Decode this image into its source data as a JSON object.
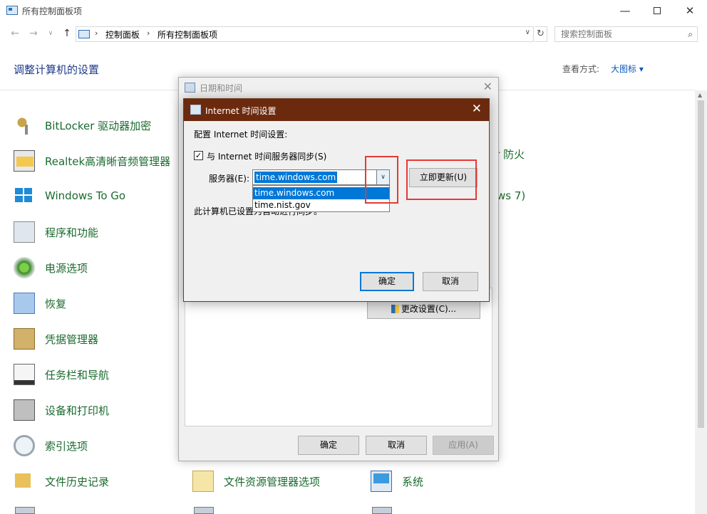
{
  "window": {
    "title": "所有控制面板项",
    "controls": {
      "minimize": "—",
      "close": "✕"
    }
  },
  "nav": {
    "back": "←",
    "forward": "→",
    "recent": "∨",
    "up": "↑",
    "breadcrumb": [
      "控制面板",
      "所有控制面板项"
    ],
    "separator": "›",
    "address_dropdown": "∨",
    "refresh": "↻",
    "search_placeholder": "搜索控制面板",
    "search_icon": "⌕"
  },
  "main": {
    "heading": "调整计算机的设置",
    "view_by_label": "查看方式:",
    "view_by_value": "大图标 ▾"
  },
  "items_col1": [
    {
      "label": "BitLocker 驱动器加密",
      "icon": "bitlocker-icon"
    },
    {
      "label": "Realtek高清晰音频管理器",
      "icon": "realtek-icon"
    },
    {
      "label": "Windows To Go",
      "icon": "windows-to-go-icon"
    },
    {
      "label": "程序和功能",
      "icon": "programs-icon"
    },
    {
      "label": "电源选项",
      "icon": "power-icon"
    },
    {
      "label": "恢复",
      "icon": "recovery-icon"
    },
    {
      "label": "凭据管理器",
      "icon": "credential-icon"
    },
    {
      "label": "任务栏和导航",
      "icon": "taskbar-icon"
    },
    {
      "label": "设备和打印机",
      "icon": "devices-printers-icon"
    },
    {
      "label": "索引选项",
      "icon": "indexing-icon"
    },
    {
      "label": "文件历史记录",
      "icon": "file-history-icon"
    }
  ],
  "items_partial": [
    {
      "label": "er 防火"
    },
    {
      "label": "ws 7)"
    }
  ],
  "items_row_bottom": [
    {
      "label": "文件资源管理器选项",
      "icon": "file-explorer-options-icon"
    },
    {
      "label": "系统",
      "icon": "system-icon"
    }
  ],
  "datetime_dialog": {
    "title": "日期和时间",
    "close": "✕",
    "change_settings": "更改设置(C)...",
    "ok": "确定",
    "cancel": "取消",
    "apply": "应用(A)"
  },
  "internet_time_dialog": {
    "title": "Internet 时间设置",
    "close": "✕",
    "config_label": "配置 Internet 时间设置:",
    "sync_checked": "✓",
    "sync_label": "与 Internet 时间服务器同步(S)",
    "server_label": "服务器(E):",
    "server_value": "time.windows.com",
    "combo_arrow": "∨",
    "server_options": [
      "time.windows.com",
      "time.nist.gov"
    ],
    "update_now": "立即更新(U)",
    "status_text": "此计算机已设置为自动进行同步。",
    "ok": "确定",
    "cancel": "取消"
  },
  "colors": {
    "link_green": "#1a6b2e",
    "heading_blue": "#1e3a8a",
    "dialog_titlebar": "#6b2a0e",
    "selection": "#0078d7",
    "highlight": "#e53935"
  }
}
